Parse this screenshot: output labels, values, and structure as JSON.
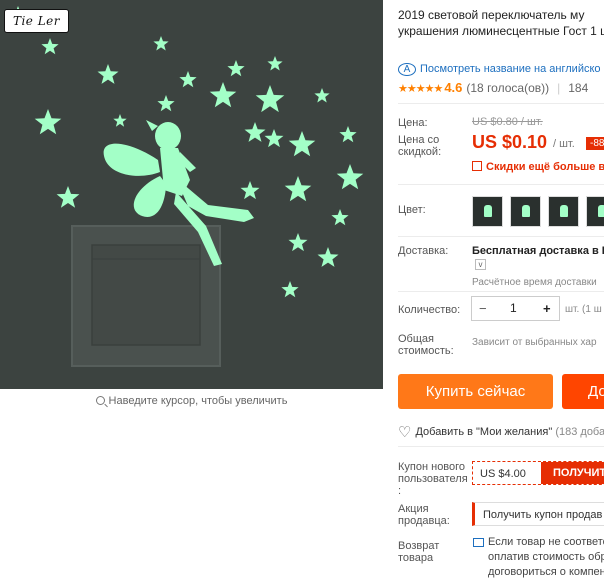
{
  "gallery": {
    "brand_logo": "Tie Ler",
    "zoom_hint": "Наведите курсор, чтобы увеличить",
    "colors": {
      "background": "#3c4340",
      "glow": "#a3ffc7",
      "switch": "#4a514e"
    }
  },
  "product": {
    "title": "2019 световой переключатель му украшения люминесцентные Гост 1 шт.",
    "translate_icon": "ai-translate-icon",
    "translate_text": "Посмотреть название на английско",
    "rating_stars": "★★★★★",
    "rating_score": "4.6",
    "rating_votes": "(18 голоса(ов))",
    "orders": "184"
  },
  "price": {
    "label": "Цена:",
    "old": "US $0.80 / шт.",
    "discount_label": "Цена со скидкой:",
    "new": "US $0.10",
    "unit": "/ шт.",
    "discount_badge": "-88",
    "promo": "Скидки ещё больше в пр"
  },
  "color": {
    "label": "Цвет:",
    "accent": "#e62e04"
  },
  "shipping": {
    "label": "Доставка:",
    "title": "Бесплатная доставка в Ru",
    "dropdown": "v",
    "time": "Расчётное время доставки"
  },
  "quantity": {
    "label": "Количество:",
    "minus": "−",
    "value": "1",
    "plus": "+",
    "note": "шт. (1 ш"
  },
  "total": {
    "label": "Общая стоимость:",
    "value": "Зависит от выбранных хар"
  },
  "actions": {
    "buy_now": "Купить сейчас",
    "add_cart": "До",
    "wishlist_icon": "heart-icon",
    "wishlist": "Добавить в \"Мои желания\"",
    "wishlist_count": "(183 доба"
  },
  "coupons": {
    "new_user_label": "Купон нового пользователя :",
    "new_user_value": "US $4.00",
    "new_user_button": "ПОЛУЧИТ",
    "seller_label": "Акция продавца:",
    "seller_button": "Получить купон продав",
    "return_label": "Возврат товара",
    "return_text": "Если товар не соответс оплатив стоимость обр договориться о компен"
  }
}
